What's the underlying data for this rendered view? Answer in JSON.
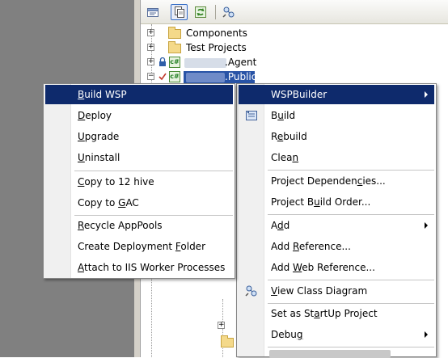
{
  "tree": {
    "items": [
      {
        "label": "Components",
        "icon": "folder-icon"
      },
      {
        "label": "Test Projects",
        "icon": "folder-icon"
      },
      {
        "label": ".Agent",
        "icon": "csharp-project-icon"
      },
      {
        "label": ".Public",
        "icon": "csharp-project-icon"
      }
    ],
    "project_icon_glyph": "c#"
  },
  "main_menu": {
    "items": [
      {
        "pre": "",
        "key": "",
        "post": "WSPBuilder",
        "submenu": true
      },
      {
        "pre": "B",
        "key": "u",
        "post": "ild",
        "submenu": false
      },
      {
        "pre": "R",
        "key": "e",
        "post": "build",
        "submenu": false
      },
      {
        "pre": "Clea",
        "key": "n",
        "post": "",
        "submenu": false
      },
      {
        "pre": "Project Dependen",
        "key": "c",
        "post": "ies...",
        "submenu": false
      },
      {
        "pre": "Project B",
        "key": "u",
        "post": "ild Order...",
        "submenu": false
      },
      {
        "pre": "A",
        "key": "d",
        "post": "d",
        "submenu": true
      },
      {
        "pre": "Add ",
        "key": "R",
        "post": "eference...",
        "submenu": false
      },
      {
        "pre": "Add ",
        "key": "W",
        "post": "eb Reference...",
        "submenu": false
      },
      {
        "pre": "",
        "key": "V",
        "post": "iew Class Diagram",
        "submenu": false
      },
      {
        "pre": "Set as St",
        "key": "a",
        "post": "rtUp Project",
        "submenu": false
      },
      {
        "pre": "Debu",
        "key": "g",
        "post": "",
        "submenu": true
      }
    ]
  },
  "wsp_menu": {
    "items": [
      {
        "pre": "",
        "key": "B",
        "post": "uild WSP"
      },
      {
        "pre": "",
        "key": "D",
        "post": "eploy"
      },
      {
        "pre": "",
        "key": "U",
        "post": "pgrade"
      },
      {
        "pre": "",
        "key": "U",
        "post": "ninstall"
      },
      {
        "pre": "",
        "key": "C",
        "post": "opy to 12 hive"
      },
      {
        "pre": "Copy to ",
        "key": "G",
        "post": "AC"
      },
      {
        "pre": "",
        "key": "R",
        "post": "ecycle AppPools"
      },
      {
        "pre": "Create Deployment ",
        "key": "F",
        "post": "older"
      },
      {
        "pre": "",
        "key": "A",
        "post": "ttach to IIS Worker Processes"
      }
    ]
  },
  "colors": {
    "highlight": "#0e2a6c",
    "desktop": "#808080"
  }
}
